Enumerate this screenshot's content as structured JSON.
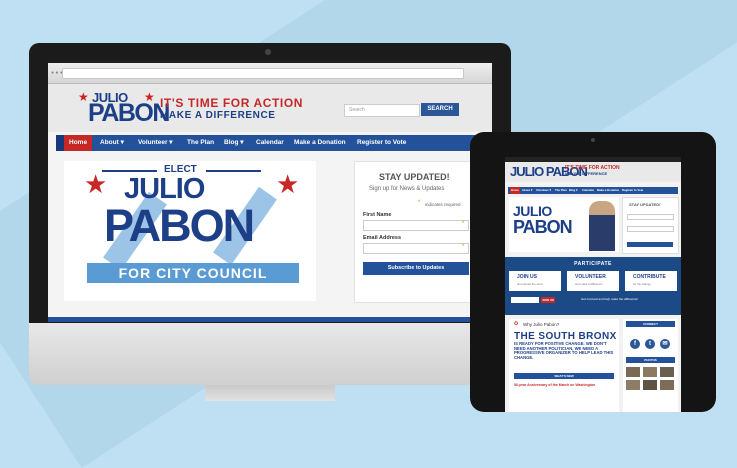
{
  "imac": {
    "search_placeholder": "Search",
    "search_button": "SEARCH",
    "logo_top": "JULIO",
    "logo_main": "PABON",
    "tagline_1": "IT'S TIME FOR ACTION",
    "tagline_2": "MAKE A DIFFERENCE",
    "nav": [
      "Home",
      "About ▾",
      "Volunteer ▾",
      "The Plan",
      "Blog ▾",
      "Calendar",
      "Make a Donation",
      "Register to Vote"
    ],
    "banner": {
      "elect": "ELECT",
      "julio": "JULIO",
      "pabon": "PABON",
      "council": "FOR CITY COUNCIL"
    },
    "form": {
      "title": "STAY UPDATED!",
      "subtitle": "Sign up for News & Updates",
      "required_note": "indicates required",
      "first_name_label": "First Name",
      "email_label": "Email Address",
      "submit": "Subscribe to Updates"
    }
  },
  "tablet": {
    "logo": "JULIO PABON",
    "tagline_1": "IT'S TIME FOR ACTION",
    "tagline_2": "MAKE A DIFFERENCE",
    "nav": [
      "Home",
      "About ▾",
      "Volunteer ▾",
      "The Plan",
      "Blog ▾",
      "Calendar",
      "Make a Donation",
      "Register to Vote"
    ],
    "banner": {
      "julio": "JULIO",
      "pabon": "PABON"
    },
    "form_title": "STAY UPDATED!",
    "participate": "PARTICIPATE",
    "cards": [
      {
        "title": "JOIN US",
        "sub": "and spread the word"
      },
      {
        "title": "VOLUNTEER",
        "sub": "and make a difference"
      },
      {
        "title": "CONTRIBUTE",
        "sub": "for the change"
      }
    ],
    "join_button": "JOIN US",
    "join_tagline": "Get involved and help make the difference!",
    "why_label": "Why Julio Pabon?",
    "south_title": "THE SOUTH BRONX",
    "south_sub": "IS READY FOR POSITIVE CHANGE. WE DON'T NEED ANOTHER POLITICIAN, WE NEED A PROGRESSIVE ORGANIZER TO HELP LEAD THIS CHANGE.",
    "whats_new": "WHAT'S NEW",
    "post_title": "50-year Anniversary of the March on Washington",
    "connect": "CONNECT",
    "photos": "PHOTOS"
  }
}
